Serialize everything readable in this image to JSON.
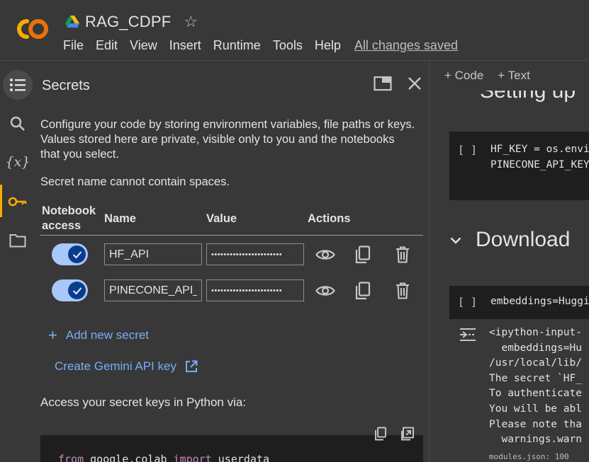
{
  "header": {
    "doc_title": "RAG_CDPF",
    "menu": [
      "File",
      "Edit",
      "View",
      "Insert",
      "Runtime",
      "Tools",
      "Help"
    ],
    "save_status": "All changes saved"
  },
  "colors": {
    "accent_link": "#7cacf8",
    "logo_orange": "#f9ab00",
    "toggle_track": "#a8c7fa",
    "toggle_knob": "#0b3c8a"
  },
  "rail": {
    "icons": [
      "toc-icon",
      "search-icon",
      "variables-icon",
      "key-icon",
      "folder-icon"
    ],
    "active": "key-icon"
  },
  "secrets": {
    "title": "Secrets",
    "description": "Configure your code by storing environment variables, file paths or keys. Values stored here are private, visible only to you and the notebooks that you select.",
    "note": "Secret name cannot contain spaces.",
    "columns": {
      "access_line1": "Notebook",
      "access_line2": "access",
      "name": "Name",
      "value": "Value",
      "actions": "Actions"
    },
    "rows": [
      {
        "enabled": true,
        "name": "HF_API",
        "value": "•••••••••••••••••••••••"
      },
      {
        "enabled": true,
        "name": "PINECONE_API_",
        "value": "•••••••••••••••••••••••"
      }
    ],
    "add_label": "Add new secret",
    "gemini_label": "Create Gemini API key",
    "access_label": "Access your secret keys in Python via:",
    "code": {
      "kw1": "from",
      "mod": " google.colab ",
      "kw2": "import",
      "name": " userdata"
    }
  },
  "notebook": {
    "toolbar": {
      "code": "+ Code",
      "text": "+ Text"
    },
    "heading_fragment": "Setting up",
    "cell1": {
      "bracket": "[ ]",
      "line1": "HF_KEY = os.environ",
      "line2": "PINECONE_API_KEY"
    },
    "section_title": "Download",
    "cell2": {
      "bracket": "[ ]",
      "line1": "embeddings=HuggingFace"
    },
    "output_lines": [
      "<ipython-input-",
      "  embeddings=Hu",
      "/usr/local/lib/",
      "The secret `HF_",
      "To authenticate",
      "You will be abl",
      "Please note tha",
      "  warnings.warn"
    ],
    "output_tail": "modules.json: 100"
  }
}
